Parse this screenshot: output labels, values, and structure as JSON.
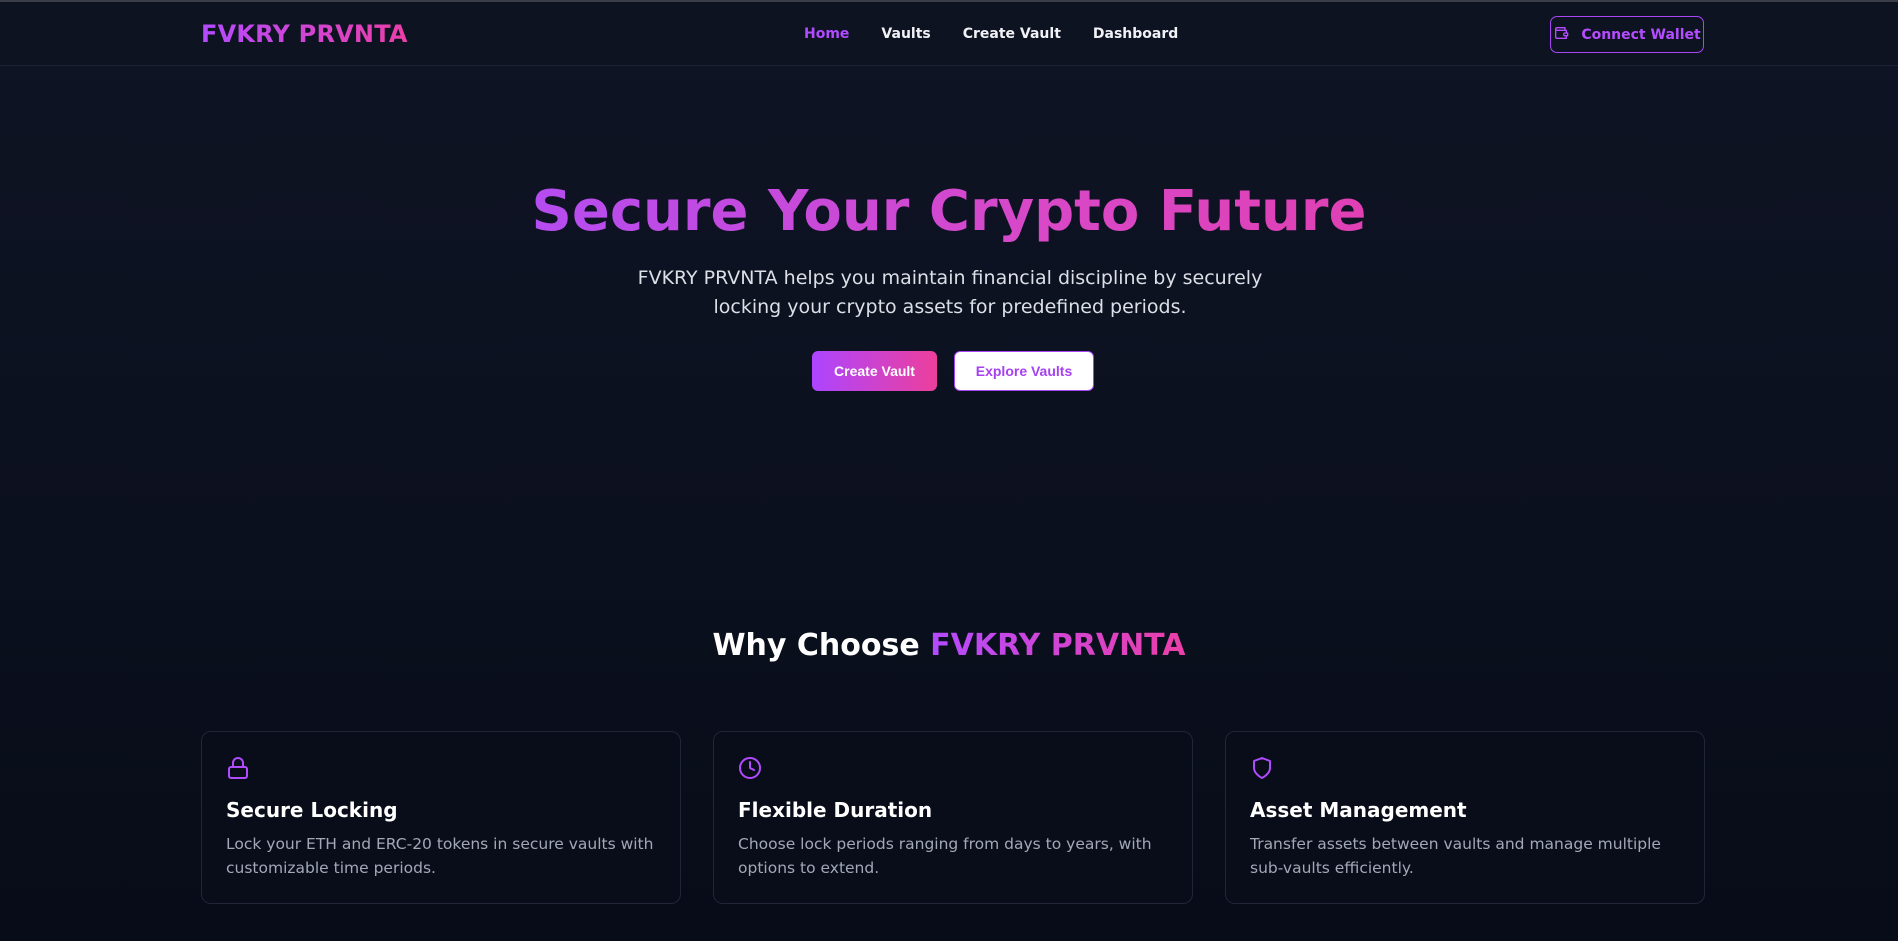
{
  "header": {
    "logo": "FVKRY PRVNTA",
    "nav": [
      {
        "label": "Home",
        "active": true
      },
      {
        "label": "Vaults",
        "active": false
      },
      {
        "label": "Create Vault",
        "active": false
      },
      {
        "label": "Dashboard",
        "active": false
      }
    ],
    "wallet_button": {
      "label": "Connect Wallet",
      "icon": "wallet-icon"
    }
  },
  "hero": {
    "title": "Secure Your Crypto Future",
    "subtitle": "FVKRY PRVNTA helps you maintain financial discipline by securely locking your crypto assets for predefined periods.",
    "primary_button": "Create Vault",
    "secondary_button": "Explore Vaults"
  },
  "features": {
    "title_prefix": "Why Choose ",
    "title_brand": "FVKRY PRVNTA",
    "cards": [
      {
        "icon": "lock-icon",
        "title": "Secure Locking",
        "text": "Lock your ETH and ERC-20 tokens in secure vaults with customizable time periods."
      },
      {
        "icon": "clock-icon",
        "title": "Flexible Duration",
        "text": "Choose lock periods ranging from days to years, with options to extend."
      },
      {
        "icon": "shield-icon",
        "title": "Asset Management",
        "text": "Transfer assets between vaults and manage multiple sub-vaults efficiently."
      }
    ]
  },
  "colors": {
    "accent_purple": "#b04bff",
    "accent_pink": "#ec3fa8",
    "background": "#0c1120"
  }
}
